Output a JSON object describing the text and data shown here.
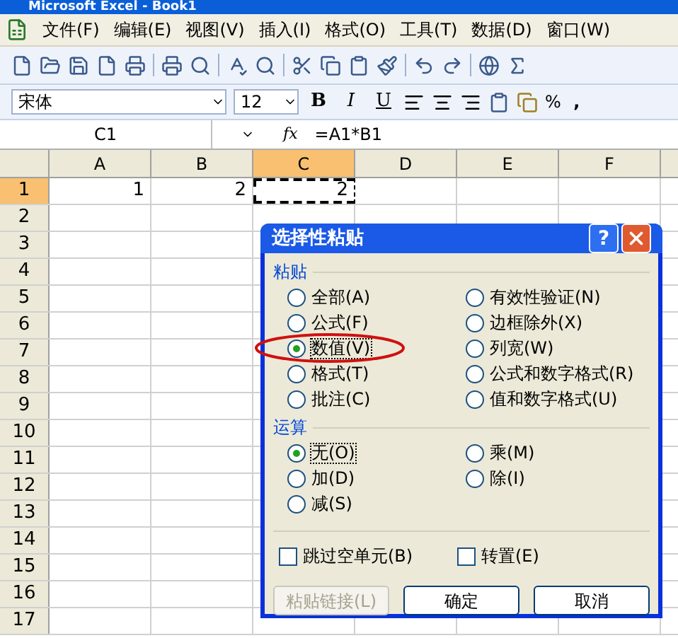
{
  "window": {
    "title": "Microsoft Excel - Book1"
  },
  "menu": [
    {
      "label": "文件(F)"
    },
    {
      "label": "编辑(E)"
    },
    {
      "label": "视图(V)"
    },
    {
      "label": "插入(I)"
    },
    {
      "label": "格式(O)"
    },
    {
      "label": "工具(T)"
    },
    {
      "label": "数据(D)"
    },
    {
      "label": "窗口(W)"
    }
  ],
  "format_toolbar": {
    "font": "宋体",
    "size": "12",
    "bold": "B",
    "italic": "I",
    "underline": "U",
    "percent": "%",
    "comma": ","
  },
  "formula_bar": {
    "name_box": "C1",
    "fx": "fx",
    "formula": "=A1*B1"
  },
  "sheet": {
    "columns": [
      {
        "label": "A",
        "selected": false
      },
      {
        "label": "B",
        "selected": false
      },
      {
        "label": "C",
        "selected": true
      },
      {
        "label": "D",
        "selected": false
      },
      {
        "label": "E",
        "selected": false
      },
      {
        "label": "F",
        "selected": false
      }
    ],
    "rows": [
      {
        "label": "1",
        "selected": true,
        "cells": [
          "1",
          "2",
          "2"
        ]
      },
      {
        "label": "2",
        "selected": false
      },
      {
        "label": "3",
        "selected": false
      },
      {
        "label": "4",
        "selected": false
      },
      {
        "label": "5",
        "selected": false
      },
      {
        "label": "6",
        "selected": false
      },
      {
        "label": "7",
        "selected": false
      },
      {
        "label": "8",
        "selected": false
      },
      {
        "label": "9",
        "selected": false
      },
      {
        "label": "10",
        "selected": false
      },
      {
        "label": "11",
        "selected": false
      },
      {
        "label": "12",
        "selected": false
      },
      {
        "label": "13",
        "selected": false
      },
      {
        "label": "14",
        "selected": false
      },
      {
        "label": "15",
        "selected": false
      },
      {
        "label": "16",
        "selected": false
      },
      {
        "label": "17",
        "selected": false
      }
    ]
  },
  "dialog": {
    "title": "选择性粘贴",
    "help": "?",
    "paste_label": "粘贴",
    "paste_options": [
      {
        "label": "全部(A)",
        "selected": false
      },
      {
        "label": "有效性验证(N)",
        "selected": false
      },
      {
        "label": "公式(F)",
        "selected": false
      },
      {
        "label": "边框除外(X)",
        "selected": false
      },
      {
        "label": "数值(V)",
        "selected": true
      },
      {
        "label": "列宽(W)",
        "selected": false
      },
      {
        "label": "格式(T)",
        "selected": false
      },
      {
        "label": "公式和数字格式(R)",
        "selected": false
      },
      {
        "label": "批注(C)",
        "selected": false
      },
      {
        "label": "值和数字格式(U)",
        "selected": false
      }
    ],
    "operation_label": "运算",
    "operation_options": [
      {
        "label": "无(O)",
        "selected": true
      },
      {
        "label": "乘(M)",
        "selected": false
      },
      {
        "label": "加(D)",
        "selected": false
      },
      {
        "label": "除(I)",
        "selected": false
      },
      {
        "label": "减(S)",
        "selected": false
      }
    ],
    "checkboxes": [
      {
        "label": "跳过空单元(B)",
        "checked": false
      },
      {
        "label": "转置(E)",
        "checked": false
      }
    ],
    "buttons": [
      {
        "label": "粘贴链接(L)",
        "disabled": true
      },
      {
        "label": "确定",
        "disabled": false
      },
      {
        "label": "取消",
        "disabled": false
      }
    ]
  }
}
